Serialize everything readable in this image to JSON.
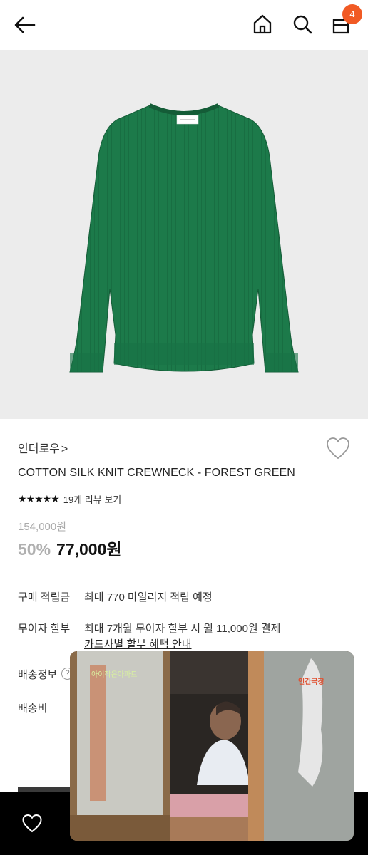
{
  "header": {
    "back_icon": "arrow-left-icon",
    "home_icon": "home-icon",
    "search_icon": "search-icon",
    "bag_icon": "shopping-bag-icon",
    "cart_count": "4",
    "badge_color": "#f15a24"
  },
  "product": {
    "brand": "인더로우",
    "brand_chevron": ">",
    "title": "COTTON SILK KNIT CREWNECK - FOREST GREEN",
    "stars": "★★★★★",
    "review_link": "19개 리뷰 보기",
    "original_price": "154,000원",
    "discount": "50%",
    "price": "77,000원",
    "garment_color": "#1c7a4a"
  },
  "details": {
    "points_label": "구매 적립금",
    "points_value": "최대 770 마일리지 적립 예정",
    "installment_label": "무이자 할부",
    "installment_value": "최대 7개월 무이자 할부 시 월 11,000원 결제",
    "card_link": "카드사별 할부 혜택 안내",
    "shipping_info_label": "배송정보",
    "shipping_help": "?",
    "shipping_fee_label": "배송비"
  },
  "bottom_bar": {
    "wishlist_icon": "heart-icon"
  },
  "video_overlay": {
    "caption_left": "아이작은아파트",
    "caption_right": "인간극장"
  }
}
